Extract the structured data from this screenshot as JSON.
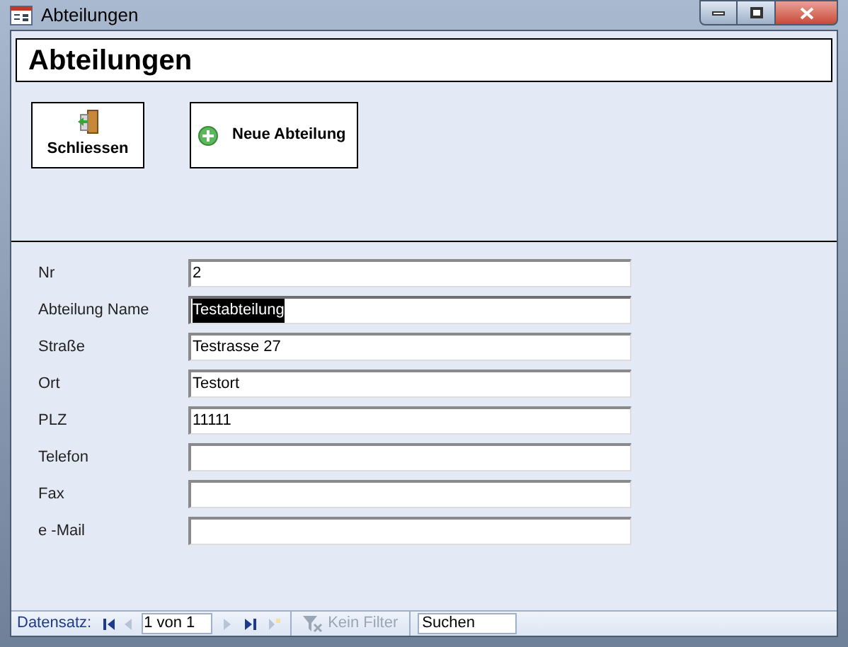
{
  "window": {
    "title": "Abteilungen"
  },
  "form_title": "Abteilungen",
  "buttons": [
    {
      "kind": "close",
      "label": "Schliessen"
    },
    {
      "kind": "add",
      "label": "Neue Abteilung"
    }
  ],
  "fields": [
    {
      "label": "Nr",
      "value": "2",
      "selected": false
    },
    {
      "label": "Abteilung Name",
      "value": "Testabteilung",
      "selected": true
    },
    {
      "label": "Straße",
      "value": "Testrasse 27",
      "selected": false
    },
    {
      "label": "Ort",
      "value": "Testort",
      "selected": false
    },
    {
      "label": "PLZ",
      "value": "11111",
      "selected": false
    },
    {
      "label": "Telefon",
      "selected": false
    },
    {
      "label": "Fax",
      "selected": false
    },
    {
      "label": "e -Mail",
      "selected": false
    }
  ],
  "status_bar": {
    "label": "Datensatz:",
    "nav": [
      {
        "kind": "first",
        "disabled": false
      },
      {
        "kind": "prev",
        "disabled": true
      }
    ],
    "record": "1 von 1",
    "nav_after": [
      {
        "kind": "next",
        "disabled": true
      },
      {
        "kind": "last",
        "disabled": false
      },
      {
        "kind": "new",
        "disabled": true
      }
    ],
    "filter": {
      "label": "Kein Filter",
      "disabled": true
    },
    "search": {
      "placeholder": "Suchen"
    }
  }
}
